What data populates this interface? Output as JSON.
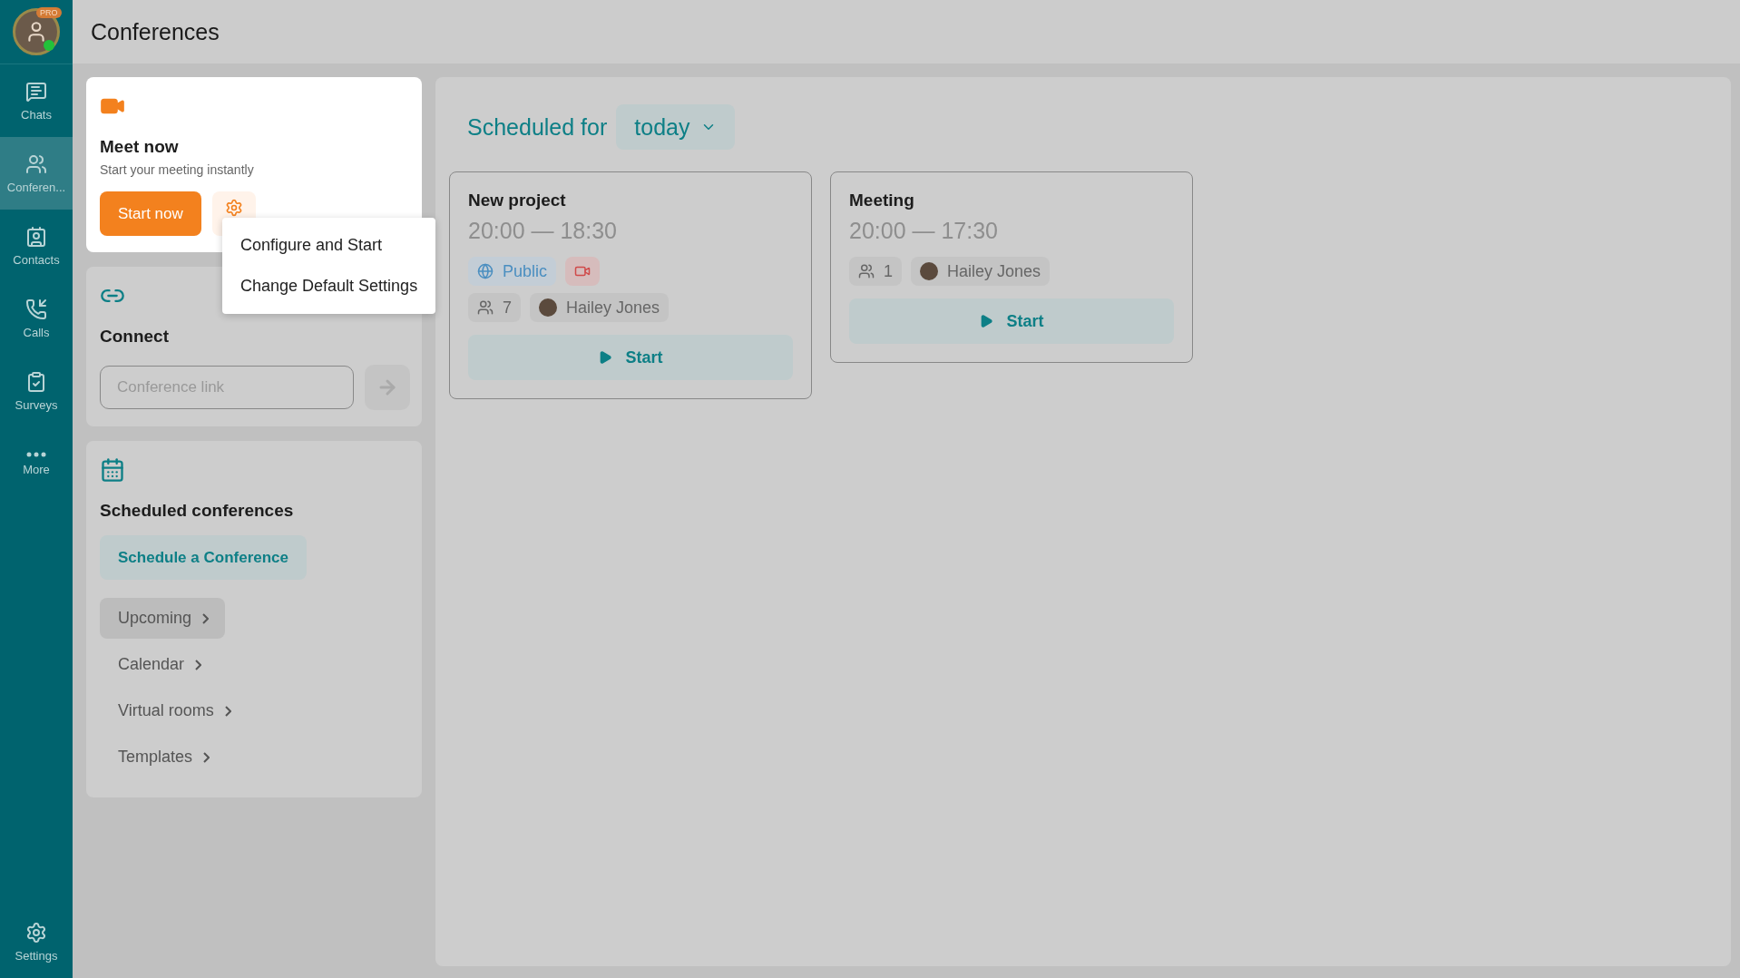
{
  "sidebar": {
    "avatar": {
      "badge": "PRO",
      "online": true
    },
    "items": [
      {
        "label": "Chats",
        "selected": false
      },
      {
        "label": "Conferen...",
        "selected": true
      },
      {
        "label": "Contacts",
        "selected": false
      },
      {
        "label": "Calls",
        "selected": false
      },
      {
        "label": "Surveys",
        "selected": false
      },
      {
        "label": "More",
        "selected": false
      }
    ],
    "settings": {
      "label": "Settings"
    }
  },
  "header": {
    "title": "Conferences"
  },
  "meet_now": {
    "title": "Meet now",
    "subtitle": "Start your meeting instantly",
    "button": "Start now",
    "menu": [
      "Configure and Start",
      "Change Default Settings"
    ]
  },
  "connect": {
    "title": "Connect",
    "placeholder": "Conference link"
  },
  "scheduled": {
    "title": "Scheduled conferences",
    "button": "Schedule a Conference",
    "links": [
      {
        "label": "Upcoming",
        "selected": true
      },
      {
        "label": "Calendar",
        "selected": false
      },
      {
        "label": "Virtual rooms",
        "selected": false
      },
      {
        "label": "Templates",
        "selected": false
      }
    ]
  },
  "schedule_view": {
    "label": "Scheduled for",
    "period": "today",
    "meetings": [
      {
        "title": "New project",
        "time": "20:00 — 18:30",
        "public": "Public",
        "recording": true,
        "participants": "7",
        "owner": "Hailey Jones",
        "button": "Start"
      },
      {
        "title": "Meeting",
        "time": "20:00 — 17:30",
        "recording": false,
        "participants": "1",
        "owner": "Hailey Jones",
        "button": "Start"
      }
    ]
  }
}
